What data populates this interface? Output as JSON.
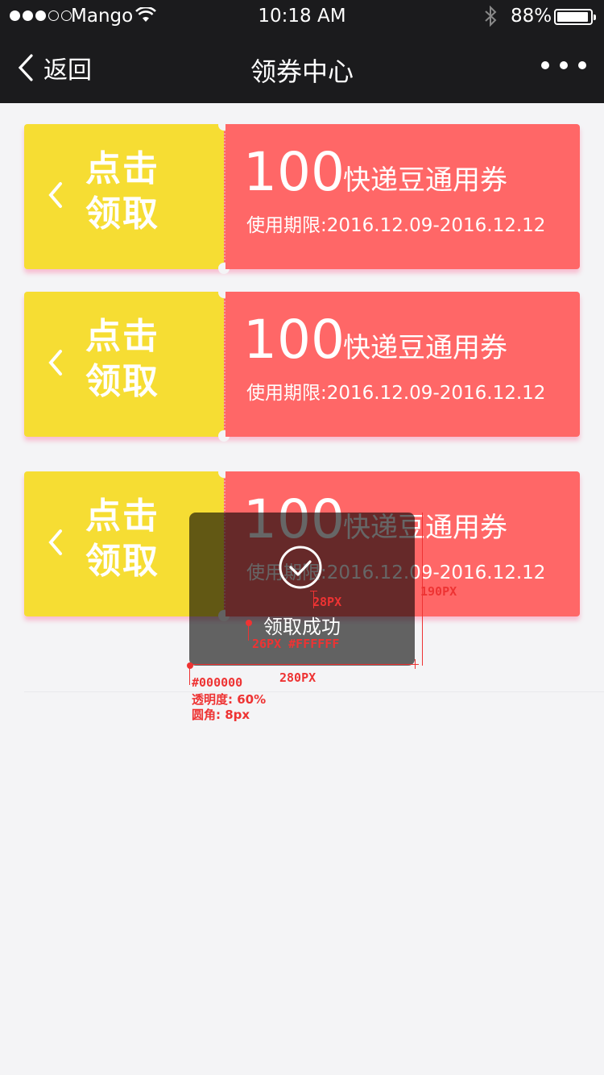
{
  "status_bar": {
    "carrier": "Mango",
    "time": "10:18 AM",
    "battery_percent": "88%",
    "battery_level": 0.88,
    "signal_filled": 3,
    "signal_total": 5
  },
  "nav": {
    "back_label": "返回",
    "title": "领券中心"
  },
  "coupons": [
    {
      "claim_label_1": "点击",
      "claim_label_2": "领取",
      "amount": "100",
      "name": "快递豆通用券",
      "period": "使用期限:2016.12.09-2016.12.12"
    },
    {
      "claim_label_1": "点击",
      "claim_label_2": "领取",
      "amount": "100",
      "name": "快递豆通用券",
      "period": "使用期限:2016.12.09-2016.12.12"
    },
    {
      "claim_label_1": "点击",
      "claim_label_2": "领取",
      "amount": "100",
      "name": "快递豆通用券",
      "period": "使用期限:2016.12.09-2016.12.12"
    }
  ],
  "toast": {
    "message": "领取成功"
  },
  "annotations": {
    "icon_gap": "28PX",
    "height": "190PX",
    "text_spec": "26PX #FFFFFF",
    "width": "280PX",
    "color": "#000000",
    "opacity": "透明度: 60%",
    "radius": "圆角: 8px"
  },
  "colors": {
    "nav_bg": "#1b1b1d",
    "coupon_left": "#f6dd33",
    "coupon_right": "#ff6767",
    "page_bg": "#f4f4f6",
    "annotation": "#ee3333"
  }
}
